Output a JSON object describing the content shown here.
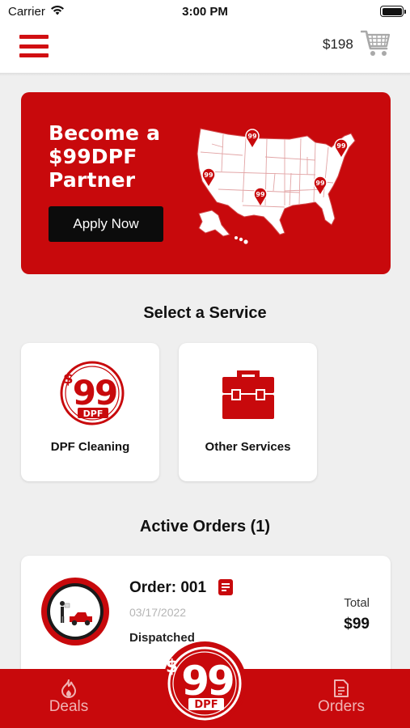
{
  "status_bar": {
    "carrier": "Carrier",
    "time": "3:00 PM",
    "wifi_icon": "wifi-icon",
    "battery_icon": "battery-icon"
  },
  "header": {
    "menu_icon": "hamburger-menu-icon",
    "cart_total": "$198",
    "cart_icon": "shopping-cart-icon"
  },
  "banner": {
    "title_line1": "Become a",
    "title_line2": "$99DPF",
    "title_line3": "Partner",
    "button_label": "Apply Now",
    "map_pin_label": "99",
    "map_icon": "usa-map-icon"
  },
  "services": {
    "title": "Select a Service",
    "items": [
      {
        "label": "DPF Cleaning",
        "icon": "dpf-99-logo-icon",
        "logo_dollar": "$",
        "logo_number": "99",
        "logo_text": "DPF"
      },
      {
        "label": "Other Services",
        "icon": "toolbox-icon"
      }
    ]
  },
  "orders": {
    "title": "Active Orders (1)",
    "items": [
      {
        "order_label": "Order: 001",
        "date": "03/17/2022",
        "status": "Dispatched",
        "total_label": "Total",
        "total_value": "$99",
        "avatar_icon": "tow-truck-icon",
        "doc_icon": "document-icon"
      }
    ]
  },
  "tab_bar": {
    "deals_label": "Deals",
    "deals_icon": "flame-icon",
    "orders_label": "Orders",
    "orders_icon": "document-icon",
    "center_logo_dollar": "$",
    "center_logo_number": "99",
    "center_logo_text": "DPF"
  },
  "colors": {
    "brand_red": "#c8090c",
    "menu_red": "#d10f12",
    "background": "#efefef",
    "card": "#ffffff",
    "dark_button": "#0c0c0c"
  }
}
